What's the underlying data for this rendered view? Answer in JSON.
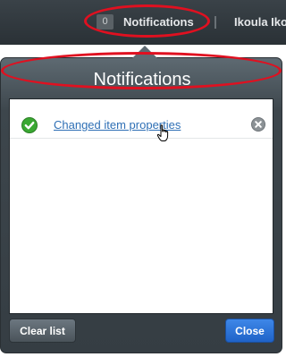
{
  "topbar": {
    "notification_count": "0",
    "notifications_label": "Notifications",
    "user_label": "Ikoula Iko"
  },
  "popover": {
    "title": "Notifications",
    "items": [
      {
        "label": "Changed item properties",
        "status_icon": "check-circle-icon",
        "remove_icon": "remove-circle-icon"
      }
    ],
    "clear_button": "Clear list",
    "close_button": "Close"
  },
  "colors": {
    "topbar": "#2f373c",
    "popover": "#3d464c",
    "link": "#2e6fb5",
    "close_button": "#2a73d8",
    "highlight": "#e01020",
    "success": "#3aa832"
  }
}
